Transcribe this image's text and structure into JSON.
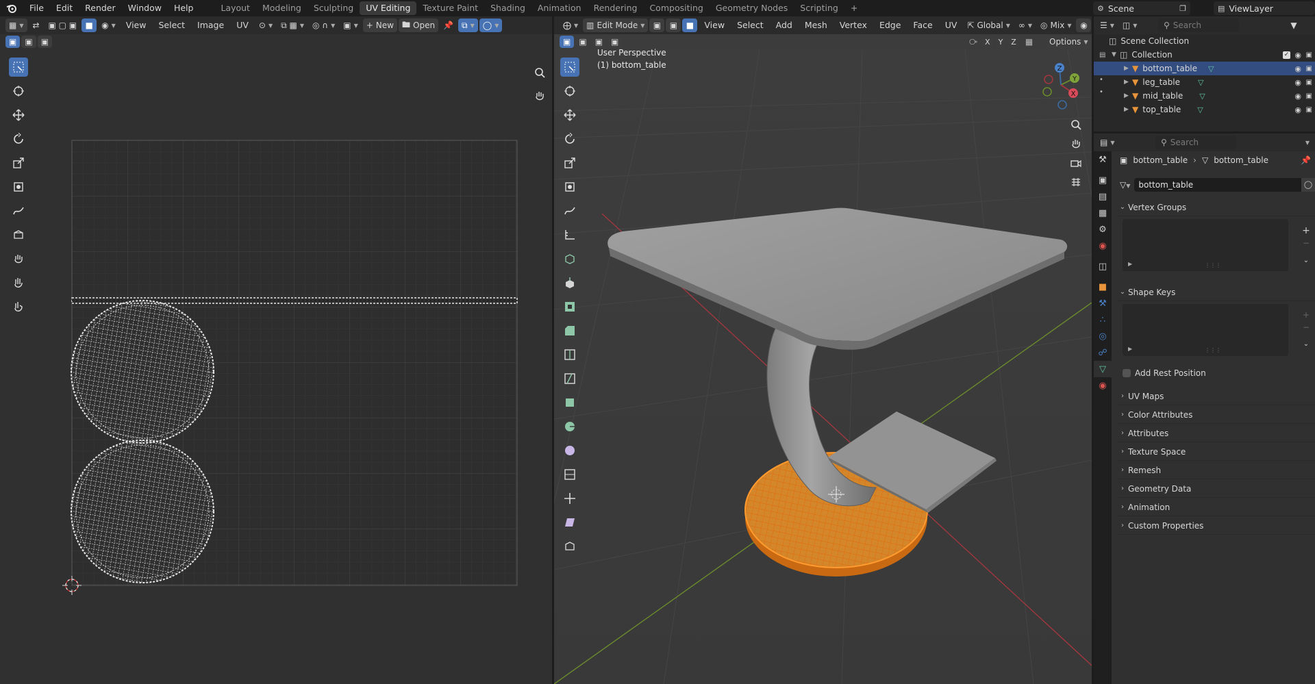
{
  "topbar": {
    "menus": [
      "File",
      "Edit",
      "Render",
      "Window",
      "Help"
    ],
    "workspaces": [
      "Layout",
      "Modeling",
      "Sculpting",
      "UV Editing",
      "Texture Paint",
      "Shading",
      "Animation",
      "Rendering",
      "Compositing",
      "Geometry Nodes",
      "Scripting"
    ],
    "active_workspace": "UV Editing",
    "scene": "Scene",
    "view_layer": "ViewLayer"
  },
  "uv_editor": {
    "menus": [
      "View",
      "Select",
      "Image",
      "UV"
    ],
    "new_label": "New",
    "open_label": "Open"
  },
  "viewport": {
    "mode": "Edit Mode",
    "menus": [
      "View",
      "Select",
      "Add",
      "Mesh",
      "Vertex",
      "Edge",
      "Face",
      "UV"
    ],
    "transform_orientation": "Global",
    "proportional": "Mix",
    "options_label": "Options",
    "axis_labels": [
      "X",
      "Y",
      "Z"
    ],
    "overlay_line1": "User Perspective",
    "overlay_line2": "(1) bottom_table",
    "gizmo_axes": {
      "x": "X",
      "y": "Y",
      "z": "Z"
    }
  },
  "outliner": {
    "search_placeholder": "Search",
    "scene_collection": "Scene Collection",
    "collection": "Collection",
    "objects": [
      "bottom_table",
      "leg_table",
      "mid_table",
      "top_table"
    ]
  },
  "properties": {
    "search_placeholder": "Search",
    "breadcrumb_object": "bottom_table",
    "breadcrumb_data": "bottom_table",
    "data_name": "bottom_table",
    "sections": {
      "vertex_groups": "Vertex Groups",
      "shape_keys": "Shape Keys",
      "add_rest_position": "Add Rest Position",
      "uv_maps": "UV Maps",
      "color_attributes": "Color Attributes",
      "attributes": "Attributes",
      "texture_space": "Texture Space",
      "remesh": "Remesh",
      "geometry_data": "Geometry Data",
      "animation": "Animation",
      "custom_properties": "Custom Properties"
    }
  },
  "colors": {
    "accent_blue": "#4772b3",
    "selection_orange": "#e87d0d",
    "mesh_gray": "#8f8f8f",
    "x_axis_red": "#a0373f",
    "y_axis_green": "#6a8a2c"
  }
}
